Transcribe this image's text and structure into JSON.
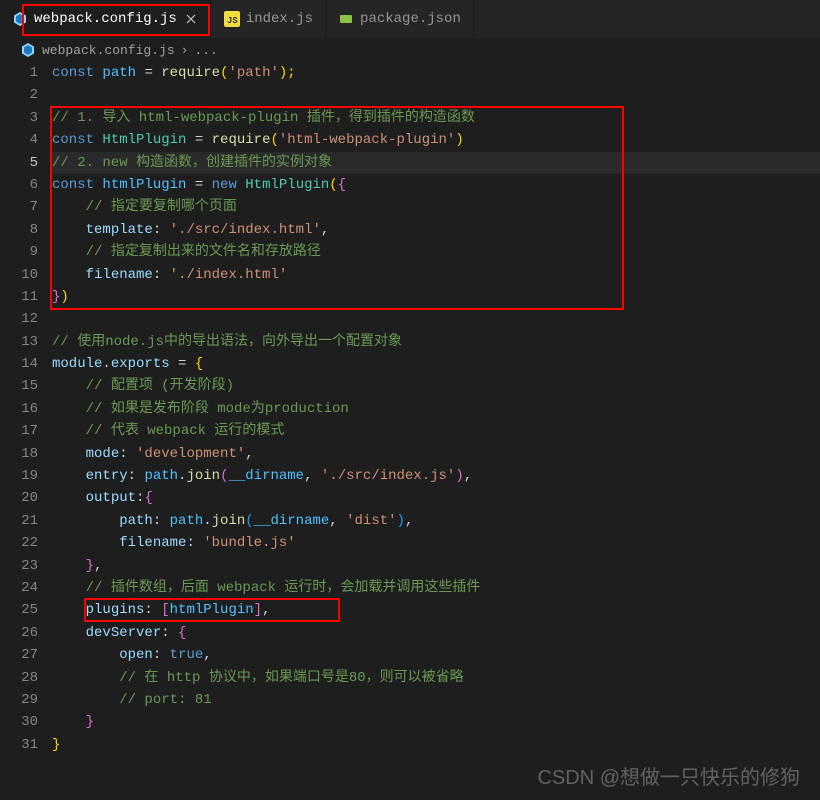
{
  "tabs": [
    {
      "label": "webpack.config.js",
      "icon": "webpack",
      "active": true,
      "closable": true
    },
    {
      "label": "index.js",
      "icon": "js",
      "active": false
    },
    {
      "label": "package.json",
      "icon": "npm",
      "active": false
    }
  ],
  "breadcrumb": {
    "file": "webpack.config.js",
    "sep": "›",
    "more": "..."
  },
  "code": {
    "l1": {
      "kw": "const",
      "var": "path",
      "op": "=",
      "fn": "require",
      "str": "'path'",
      "end": ");"
    },
    "l3": "// 1. 导入 html-webpack-plugin 插件，得到插件的构造函数",
    "l4": {
      "kw": "const",
      "cls": "HtmlPlugin",
      "op": "=",
      "fn": "require",
      "str": "'html-webpack-plugin'"
    },
    "l5": "// 2. new 构造函数，创建插件的实例对象",
    "l6": {
      "kw": "const",
      "var": "htmlPlugin",
      "op": "=",
      "new": "new",
      "cls": "HtmlPlugin"
    },
    "l7": "// 指定要复制哪个页面",
    "l8": {
      "key": "template",
      "str": "'./src/index.html'"
    },
    "l9": "// 指定复制出来的文件名和存放路径",
    "l10": {
      "key": "filename",
      "str": "'./index.html'"
    },
    "l13": "// 使用node.js中的导出语法，向外导出一个配置对象",
    "l14": {
      "mod": "module",
      "exp": "exports"
    },
    "l15": "// 配置项 (开发阶段)",
    "l16": "// 如果是发布阶段 mode为production",
    "l17": "// 代表 webpack 运行的模式",
    "l18": {
      "key": "mode",
      "str": "'development'"
    },
    "l19": {
      "key": "entry",
      "path": "path",
      "join": "join",
      "dir": "__dirname",
      "str": "'./src/index.js'"
    },
    "l20": {
      "key": "output"
    },
    "l21": {
      "key": "path",
      "path": "path",
      "join": "join",
      "dir": "__dirname",
      "str": "'dist'"
    },
    "l22": {
      "key": "filename",
      "str": "'bundle.js'"
    },
    "l24": "// 插件数组，后面 webpack 运行时，会加载并调用这些插件",
    "l25": {
      "key": "plugins",
      "var": "htmlPlugin"
    },
    "l26": {
      "key": "devServer"
    },
    "l27": {
      "key": "open",
      "val": "true"
    },
    "l28": "// 在 http 协议中，如果端口号是80，则可以被省略",
    "l29": "// port: 81"
  },
  "watermark": "CSDN @想做一只快乐的修狗"
}
